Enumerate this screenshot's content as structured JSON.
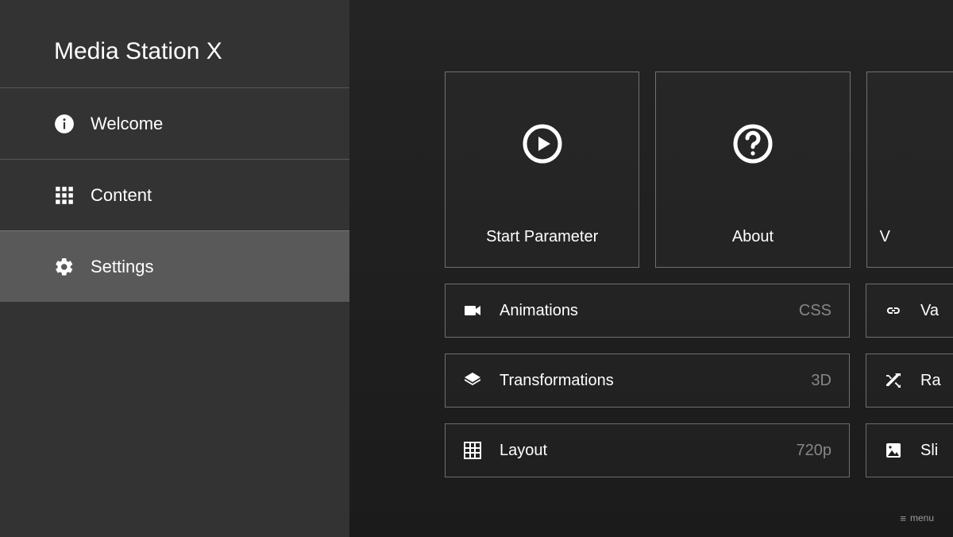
{
  "app_title": "Media Station X",
  "sidebar": {
    "items": [
      {
        "label": "Welcome",
        "icon": "info",
        "selected": false
      },
      {
        "label": "Content",
        "icon": "apps",
        "selected": false
      },
      {
        "label": "Settings",
        "icon": "gear",
        "selected": true
      }
    ]
  },
  "main": {
    "tiles": [
      {
        "label": "Start Parameter",
        "icon": "play-circle"
      },
      {
        "label": "About",
        "icon": "help-circle"
      },
      {
        "label": "V",
        "icon": "partial",
        "partial": true
      }
    ],
    "rows": [
      {
        "label": "Animations",
        "value": "CSS",
        "icon": "video",
        "side_icon": "link",
        "side_label": "Va"
      },
      {
        "label": "Transformations",
        "value": "3D",
        "icon": "layers",
        "side_icon": "shuffle",
        "side_label": "Ra"
      },
      {
        "label": "Layout",
        "value": "720p",
        "icon": "grid",
        "side_icon": "image",
        "side_label": "Sli"
      }
    ]
  },
  "footer": {
    "menu_label": "menu"
  }
}
